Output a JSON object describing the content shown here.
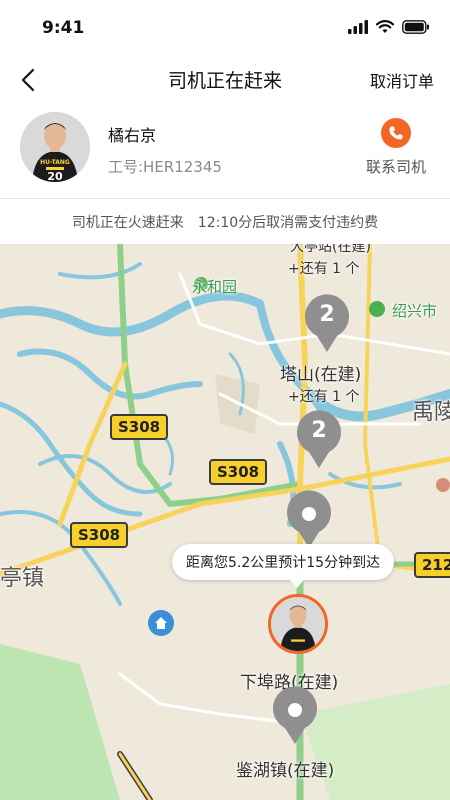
{
  "status_bar": {
    "time": "9:41"
  },
  "nav": {
    "title": "司机正在赶来",
    "cancel_label": "取消订单"
  },
  "driver": {
    "name": "橘右京",
    "employee_id": "工号:HER12345",
    "contact_label": "联系司机",
    "jersey_text": "HU-TANG"
  },
  "notice": {
    "text": "司机正在火速赶来　12:10分后取消需支付违约费"
  },
  "map": {
    "labels": {
      "station": "大亭站(在建)",
      "more1": "+还有 1 个",
      "yonghe": "永和园",
      "shaoxing": "绍兴市",
      "tashan": "塔山(在建)",
      "more2": "+还有 1 个",
      "yu": "禹陵",
      "ting": "亭镇",
      "xiafu": "下埠路(在建)",
      "jianhu": "鉴湖镇(在建)"
    },
    "routes": {
      "s308_a": "S308",
      "s308_b": "S308",
      "s308_c": "S308",
      "g12": "212"
    },
    "clusters": {
      "top": "2",
      "middle": "2"
    },
    "eta": "距离您5.2公里预计15分钟到达"
  },
  "colors": {
    "accent": "#f26522",
    "cluster": "#8f8f8f",
    "water": "#87c6dc",
    "road_major": "#f7d35c",
    "road_green": "#8ed08a"
  }
}
